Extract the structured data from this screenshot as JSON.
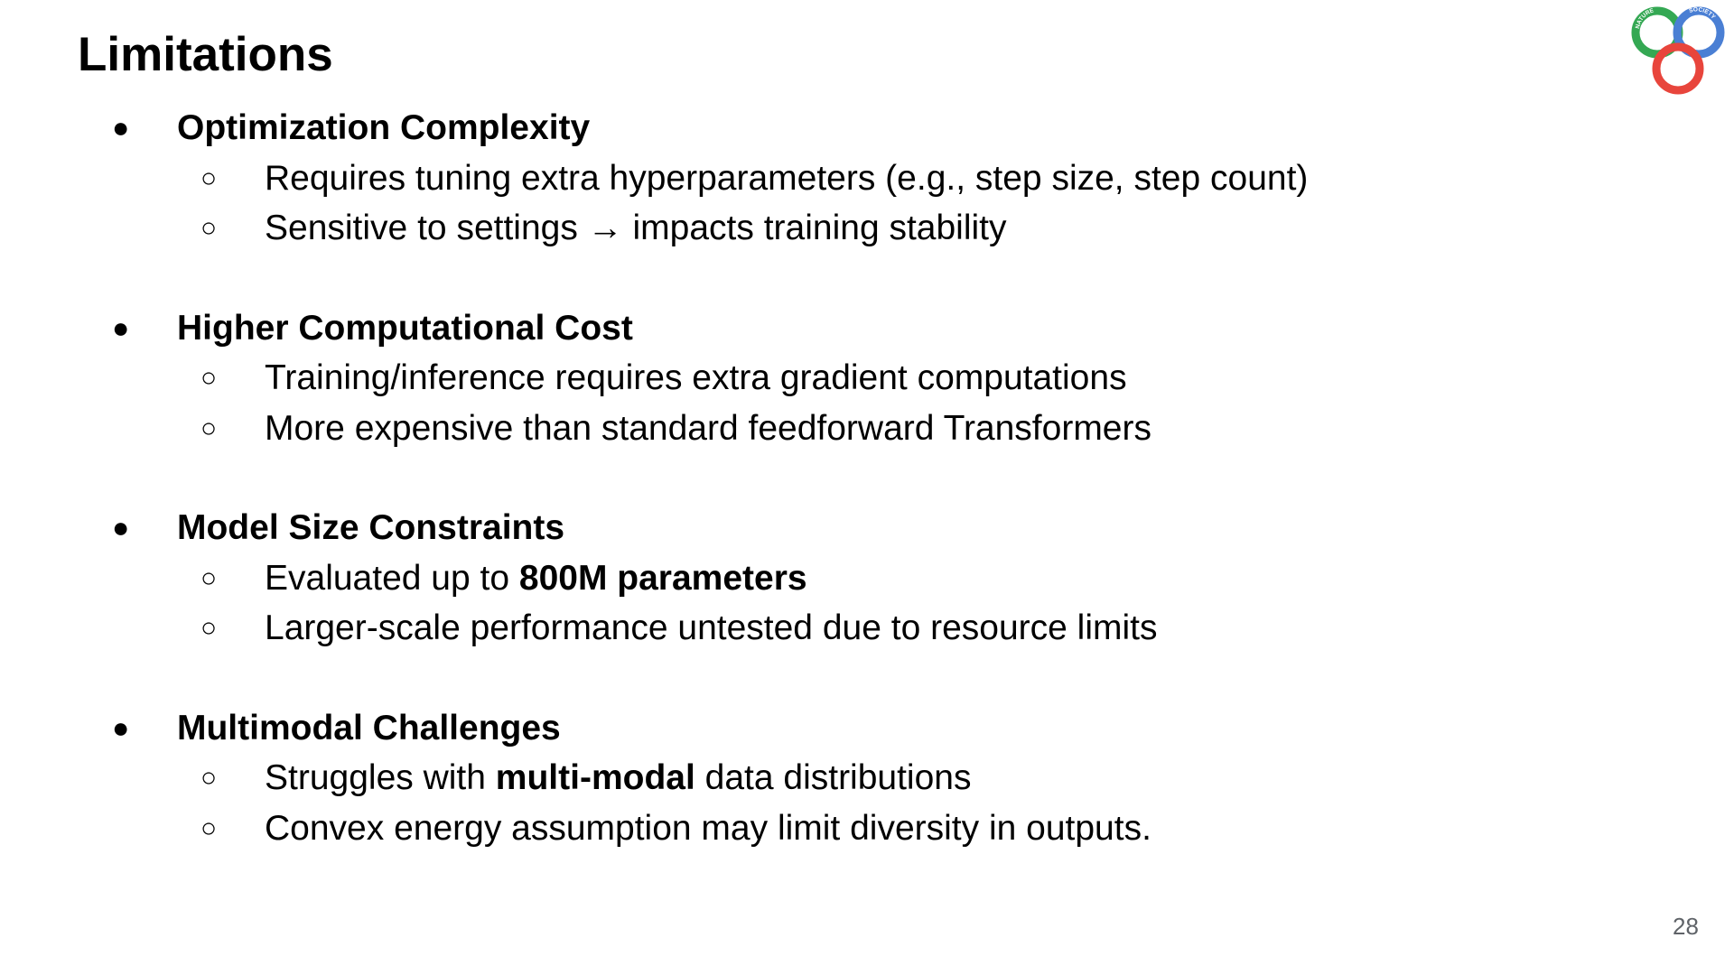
{
  "slide": {
    "title": "Limitations",
    "page_number": "28"
  },
  "logo": {
    "name": "nature-society-computation-logo",
    "texts": [
      "NATURE",
      "SOCIETY",
      "COMPUTATION"
    ],
    "colors": {
      "green": "#34a853",
      "blue": "#4a7fd4",
      "red": "#e8453c"
    }
  },
  "markers": {
    "level1": "●",
    "level2": "○"
  },
  "sections": [
    {
      "heading": "Optimization Complexity",
      "items": [
        {
          "pre": "Requires tuning extra hyperparameters (e.g., step size, step count)",
          "bold": "",
          "post": ""
        },
        {
          "pre": "Sensitive to settings → impacts training stability",
          "bold": "",
          "post": ""
        }
      ]
    },
    {
      "heading": "Higher Computational Cost",
      "items": [
        {
          "pre": "Training/inference requires extra gradient computations",
          "bold": "",
          "post": ""
        },
        {
          "pre": "More expensive than standard feedforward Transformers",
          "bold": "",
          "post": ""
        }
      ]
    },
    {
      "heading": "Model Size Constraints",
      "items": [
        {
          "pre": "Evaluated up to ",
          "bold": "800M parameters",
          "post": ""
        },
        {
          "pre": "Larger-scale performance untested due to resource limits",
          "bold": "",
          "post": ""
        }
      ]
    },
    {
      "heading": "Multimodal Challenges",
      "items": [
        {
          "pre": "Struggles with ",
          "bold": "multi-modal",
          "post": " data distributions"
        },
        {
          "pre": "Convex energy assumption may limit diversity in outputs.",
          "bold": "",
          "post": ""
        }
      ]
    }
  ]
}
